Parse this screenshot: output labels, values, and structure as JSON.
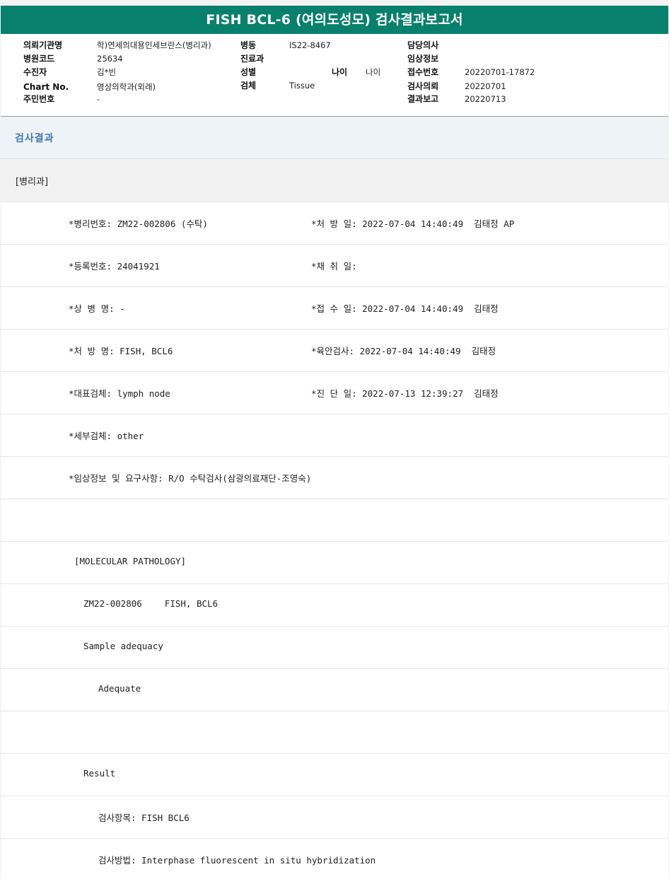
{
  "report": {
    "title": "FISH BCL-6 (여의도성모) 검사결과보고서"
  },
  "header": {
    "col1": [
      {
        "label": "의뢰기관명",
        "value": "학)연세의대용인세브란스(병리과)"
      },
      {
        "label": "병원코드",
        "value": "25634"
      },
      {
        "label": "수진자",
        "value": "김*빈"
      },
      {
        "label": "Chart No.",
        "value": "영상의학과(외래)"
      },
      {
        "label": "주민번호",
        "value": "-"
      }
    ],
    "col2": [
      {
        "label": "병동",
        "value": "IS22-8467"
      },
      {
        "label": "진료과",
        "value": ""
      },
      {
        "label": "성별",
        "value": ""
      },
      {
        "label": "검체",
        "value": "Tissue"
      }
    ],
    "age": {
      "label": "나이",
      "value": "나이"
    },
    "col3": [
      {
        "label": "담당의사",
        "value": ""
      },
      {
        "label": "임상정보",
        "value": ""
      },
      {
        "label": "접수번호",
        "value": "20220701-17872"
      },
      {
        "label": "검사의뢰",
        "value": "20220701"
      },
      {
        "label": "결과보고",
        "value": "20220713"
      }
    ]
  },
  "section": {
    "title": "검사결과",
    "subtitle": "[병리과]"
  },
  "rows": {
    "r1a": "*병리번호: ZM22-002806 (수탁)",
    "r1b": "*처 방 일: 2022-07-04 14:40:49  김태정 AP",
    "r2a": "*등록번호: 24041921",
    "r2b": "*채 취 일:",
    "r3a": "*상 병 명: -",
    "r3b": "*접 수 일: 2022-07-04 14:40:49  김태정",
    "r4a": "*처 방 명: FISH, BCL6",
    "r4b": "*육안검사: 2022-07-04 14:40:49  김태정",
    "r5a": "*대표검체: lymph node",
    "r5b": "*진 단 일: 2022-07-13 12:39:27  김태정",
    "r6a": "*세부검체: other",
    "r7a": "*임상정보 및 요구사항: R/O 수탁검사(삼광의료재단-조영숙)",
    "r9a": "[MOLECULAR PATHOLOGY]",
    "r10a": "ZM22-002806",
    "r10b": "FISH, BCL6",
    "r11a": "Sample adequacy",
    "r12a": "Adequate",
    "r14a": "Result",
    "r15a": "검사항목: FISH BCL6",
    "r16a": "검사방법: Interphase fluorescent in situ hybridization"
  }
}
